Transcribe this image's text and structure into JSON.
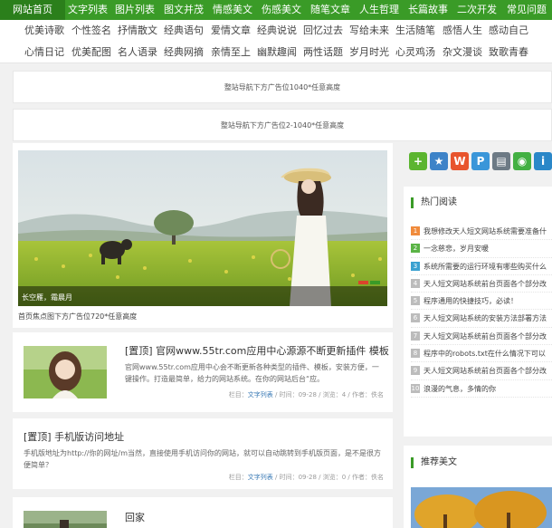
{
  "topnav": [
    "网站首页",
    "文字列表",
    "图片列表",
    "图文并茂",
    "情感美文",
    "伤感美文",
    "随笔文章",
    "人生哲理",
    "长篇故事",
    "二次开发",
    "常见问题"
  ],
  "subnav_row1": [
    "优美诗歌",
    "个性签名",
    "抒情散文",
    "经典语句",
    "爱情文章",
    "经典说说",
    "回忆过去",
    "写给未来",
    "生活随笔",
    "感悟人生",
    "感动自己"
  ],
  "subnav_row2": [
    "心情日记",
    "优美配图",
    "名人语录",
    "经典网摘",
    "亲情至上",
    "幽默趣闻",
    "两性话题",
    "岁月时光",
    "心灵鸡汤",
    "杂文漫谈",
    "致歌青春"
  ],
  "ads": {
    "nav_below_1": "整站导航下方广告位1040*任意高度",
    "nav_below_2": "整站导航下方广告位2-1040*任意高度",
    "focus_below": "首页焦点图下方广告位720*任意高度"
  },
  "slide": {
    "caption": "长空雁，霜晨月",
    "dot_colors": [
      "#d9442c",
      "#3a9b27"
    ]
  },
  "articles": [
    {
      "title": "[置顶] 官网www.55tr.com应用中心源源不断更新插件 模板",
      "excerpt": "官网www.55tr.com应用中心会不断更新各种类型的插件、模板，安装方便，一键操作。打造最简单，给力的网站系统。在你的网站后台“应。",
      "meta_prefix": "栏目：",
      "category": "文字列表",
      "meta_suffix": " / 时间：09-28 / 浏览：4 / 作者：佚名"
    },
    {
      "title": "[置顶] 手机版访问地址",
      "excerpt": "手机版地址为http://你的网址/m当然，直接使用手机访问你的网站，就可以自动跳转到手机版页面，是不是很方便简单？",
      "meta_prefix": "栏目：",
      "category": "文字列表",
      "meta_suffix": " / 时间：09-28 / 浏览：0 / 作者：佚名"
    },
    {
      "title": "回家"
    }
  ],
  "share_icons": [
    {
      "name": "add-share-icon",
      "glyph": "+",
      "color": "#5cb530"
    },
    {
      "name": "favorite-star-icon",
      "glyph": "★",
      "color": "#3d83c8"
    },
    {
      "name": "weibo-icon",
      "glyph": "W",
      "color": "#e8542d"
    },
    {
      "name": "qzone-icon",
      "glyph": "P",
      "color": "#3a96d9"
    },
    {
      "name": "print-icon",
      "glyph": "▤",
      "color": "#6d7a85"
    },
    {
      "name": "wechat-icon",
      "glyph": "◉",
      "color": "#43b043"
    },
    {
      "name": "info-icon",
      "glyph": "i",
      "color": "#2a87c8"
    }
  ],
  "hot": {
    "heading": "热门阅读",
    "num_colors": [
      "#f08b3c",
      "#5bb446",
      "#3aa1d0",
      "#bcbcbc"
    ],
    "items": [
      "我想修改天人短文网站系统需要准备什",
      "一念慈悲，岁月安暖",
      "系统所需要的运行环境有哪些购买什么",
      "天人短文网站系统前台页面各个部分改",
      "程序通用的快捷技巧，必读！",
      "天人短文网站系统的安装方法部署方法",
      "天人短文网站系统前台页面各个部分改",
      "程序中的robots.txt在什么情况下可以",
      "天人短文网站系统前台页面各个部分改",
      "浪漫的气息，多情的你"
    ]
  },
  "recommend": {
    "heading": "推荐美文"
  }
}
